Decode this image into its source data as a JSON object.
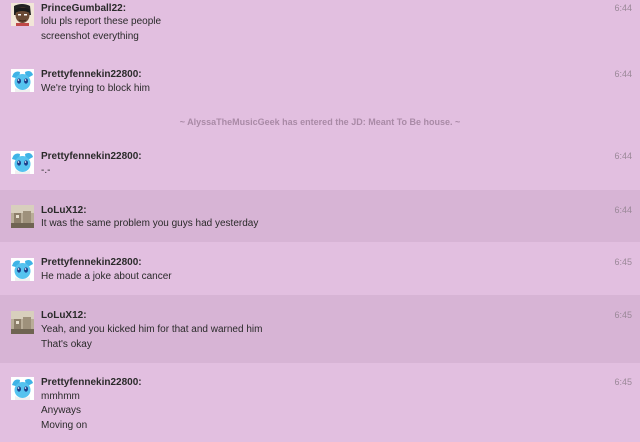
{
  "messages": [
    {
      "username": "PrinceGumball22:",
      "avatar": "prince-avatar",
      "time": "6:44",
      "lines": [
        "lolu pls report these people",
        "screenshot everything"
      ]
    },
    {
      "username": "Prettyfennekin22800:",
      "avatar": "fennekin-avatar",
      "time": "6:44",
      "lines": [
        "We're trying to block him"
      ]
    },
    {
      "username": "Prettyfennekin22800:",
      "avatar": "fennekin-avatar",
      "time": "6:44",
      "lines": [
        "-.-"
      ]
    },
    {
      "username": "LoLuX12:",
      "avatar": "lolux-avatar",
      "time": "6:44",
      "lines": [
        "It was the same problem you guys had yesterday"
      ]
    },
    {
      "username": "Prettyfennekin22800:",
      "avatar": "fennekin-avatar",
      "time": "6:45",
      "lines": [
        "He made a joke about cancer"
      ]
    },
    {
      "username": "LoLuX12:",
      "avatar": "lolux-avatar",
      "time": "6:45",
      "lines": [
        "Yeah, and you kicked him for that and warned him",
        "That's okay"
      ]
    },
    {
      "username": "Prettyfennekin22800:",
      "avatar": "fennekin-avatar",
      "time": "6:45",
      "lines": [
        "mmhmm",
        "Anyways",
        "Moving on"
      ]
    }
  ],
  "system_message": "~ AlyssaTheMusicGeek has entered the JD: Meant To Be house. ~",
  "colors": {
    "background": "#e2bfe0",
    "alt_row": "#d7b4d5",
    "system_text": "#a98aa6",
    "timestamp": "#9a8898"
  }
}
